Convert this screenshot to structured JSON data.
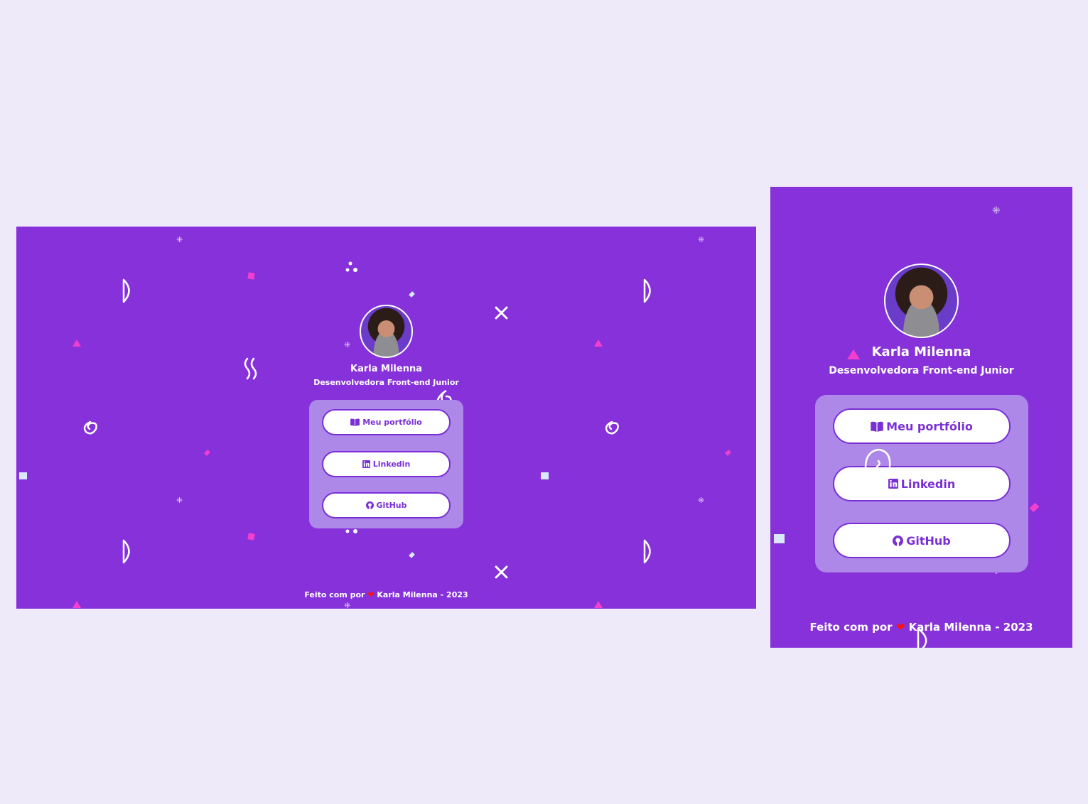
{
  "profile": {
    "name": "Karla Milenna",
    "role": "Desenvolvedora Front-end Junior"
  },
  "links": {
    "portfolio": "Meu portfólio",
    "linkedin": "Linkedin",
    "github": "GitHub"
  },
  "footer": {
    "prefix": "Feito com por",
    "heart": "❤",
    "suffix": "Karla Milenna - 2023"
  },
  "icons": {
    "portfolio": "book-open-icon",
    "linkedin": "linkedin-icon",
    "github": "github-icon",
    "heart": "heart-icon"
  },
  "colors": {
    "page_background": "#efeaf9",
    "frame_background": "#8631d9",
    "card_background": "#ad88e9",
    "button_text": "#7a2fd6",
    "accent_pink": "#f23fd0",
    "heart": "#ff1010"
  }
}
